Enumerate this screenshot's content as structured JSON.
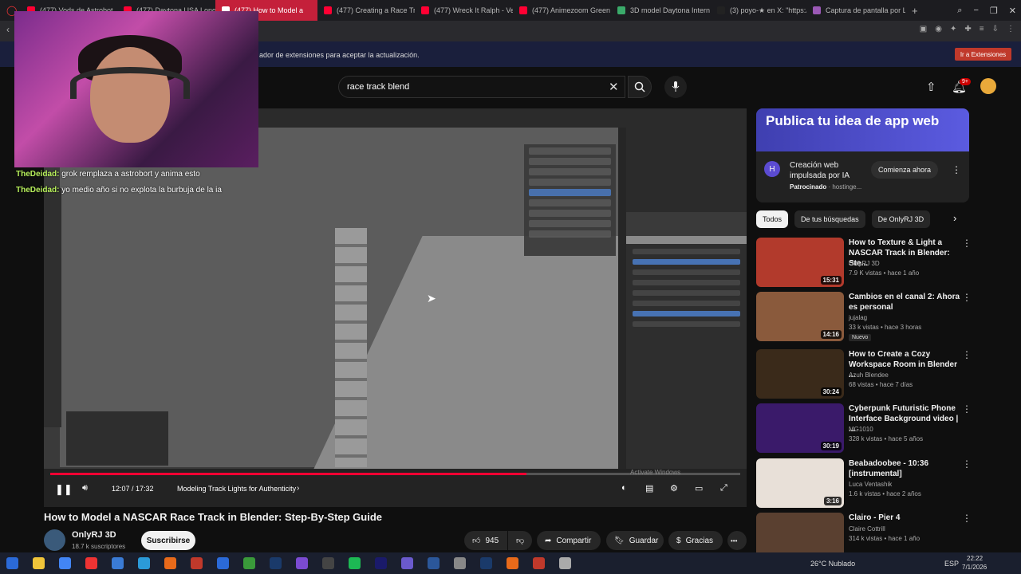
{
  "browser": {
    "tabs": [
      {
        "label": "(477) Vods de Astrobot",
        "color": "#ff0033"
      },
      {
        "label": "(477) Daytona USA Long",
        "color": "#ff0033"
      },
      {
        "label": "(477) How to Model a",
        "color": "#ff0033",
        "active": true
      },
      {
        "label": "(477) Creating a Race Tr",
        "color": "#ff0033"
      },
      {
        "label": "(477) Wreck It Ralph - Ve",
        "color": "#ff0033"
      },
      {
        "label": "(477) Animezoom Green",
        "color": "#ff0033"
      },
      {
        "label": "3D model Daytona Intern",
        "color": "#3aaa6a"
      },
      {
        "label": "(3) poyo-★ en X: \"https://",
        "color": "#222222"
      },
      {
        "label": "Captura de pantalla por L",
        "color": "#9b59b6"
      }
    ],
    "new_tab": "+",
    "window_controls": [
      "⌕",
      "−",
      "❐",
      "✕"
    ]
  },
  "notice": {
    "text": "ador de extensiones para aceptar la actualización.",
    "button": "Ir a Extensiones"
  },
  "header": {
    "search_value": "race track blend",
    "clear": "✕",
    "notifications_badge": "9+"
  },
  "chat": [
    {
      "user": "TheDeidad:",
      "message": "grok remplaza a astrobort y anima esto"
    },
    {
      "user": "TheDeidad:",
      "message": "yo medio año si no explota la burbuja de la ia"
    }
  ],
  "player": {
    "time": "12:07 / 17:32",
    "chapter": "Modeling Track Lights for Authenticity",
    "chapter_arrow": "›",
    "progress": 0.69,
    "watermark": "Activate Windows"
  },
  "video": {
    "title": "How to Model a NASCAR Race Track in Blender: Step-By-Step Guide",
    "channel": "OnlyRJ 3D",
    "subscribers": "18.7 k suscriptores",
    "subscribe": "Suscribirse",
    "likes": "945",
    "share": "Compartir",
    "save": "Guardar",
    "thanks": "Gracias",
    "more": "•••"
  },
  "ad": {
    "banner": "Publica tu idea de app web",
    "line1": "Creación web",
    "line2": "impulsada por IA",
    "sponsored": "Patrocinado",
    "advertiser": "· hostinge...",
    "cta": "Comienza ahora"
  },
  "chips": [
    "Todos",
    "De tus búsquedas",
    "De OnlyRJ 3D"
  ],
  "recommendations": [
    {
      "title": "How to Texture & Light a NASCAR Track in Blender: Ste...",
      "channel": "OnlyRJ 3D",
      "meta": "7.9 K vistas • hace 1 año",
      "duration": "15:31",
      "thumb": "#b23a2c"
    },
    {
      "title": "Cambios en el canal 2: Ahora es personal",
      "channel": "jujalag",
      "meta": "33 k vistas • hace 3 horas",
      "duration": "14:16",
      "badge": "Nuevo",
      "thumb": "#8a5a3c"
    },
    {
      "title": "How to Create a Cozy Workspace Room in Blender ...",
      "channel": "Azuh Blendee",
      "meta": "68 vistas • hace 7 días",
      "duration": "30:24",
      "thumb": "#3a2a1a"
    },
    {
      "title": "Cyberpunk Futuristic Phone Interface Background video | ...",
      "channel": "MG1010",
      "meta": "328 k vistas • hace 5 años",
      "duration": "30:19",
      "thumb": "#3a1a6a"
    },
    {
      "title": "Beabadoobee - 10:36 [instrumental]",
      "channel": "Luca Ventashik",
      "meta": "1.6 k vistas • hace 2 años",
      "duration": "3:16",
      "thumb": "#e8e0d8"
    },
    {
      "title": "Clairo - Pier 4",
      "channel": "Claire Cottrill",
      "meta": "314 k vistas • hace 1 año",
      "duration": "",
      "thumb": "#5a4030"
    }
  ],
  "taskbar": {
    "weather": "26°C  Nublado",
    "lang": "ESP",
    "time": "22:22",
    "date": "7/1/2026"
  }
}
